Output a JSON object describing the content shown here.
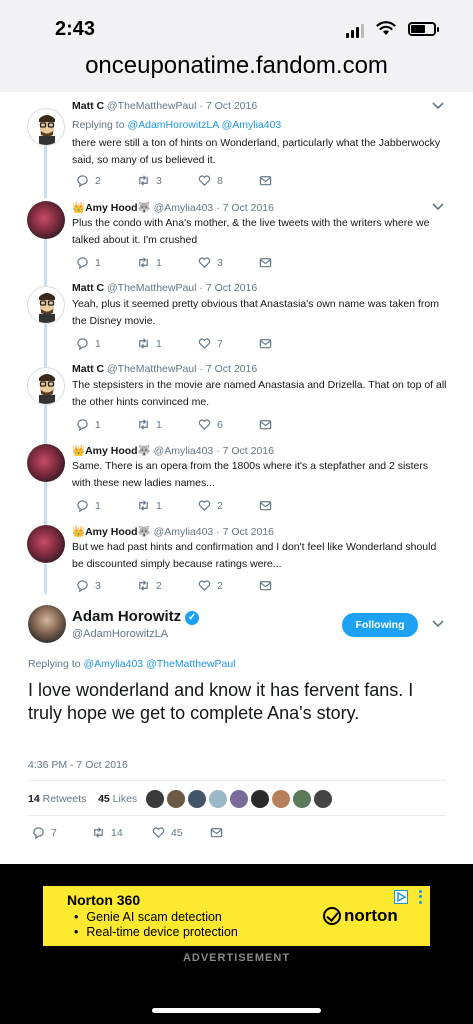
{
  "status_bar": {
    "time": "2:43"
  },
  "browser": {
    "url": "onceuponatime.fandom.com"
  },
  "thread": [
    {
      "name": "Matt C",
      "handle": "@TheMatthewPaul",
      "date": "7 Oct 2016",
      "replying_label": "Replying to",
      "replying_to": [
        "@AdamHorowitzLA",
        "@Amylia403"
      ],
      "text": "there were still a ton of hints on Wonderland, particularly what the Jabberwocky said, so many of us believed it.",
      "replies": "2",
      "retweets": "3",
      "likes": "8"
    },
    {
      "name": "Amy Hood",
      "handle": "@Amylia403",
      "date": "7 Oct 2016",
      "text": "Plus the condo with Ana's mother, & the live tweets with the writers where we talked about it. I'm crushed",
      "replies": "1",
      "retweets": "1",
      "likes": "3"
    },
    {
      "name": "Matt C",
      "handle": "@TheMatthewPaul",
      "date": "7 Oct 2016",
      "text": "Yeah, plus it seemed pretty obvious that Anastasia's own name was taken from the Disney movie.",
      "replies": "1",
      "retweets": "1",
      "likes": "7"
    },
    {
      "name": "Matt C",
      "handle": "@TheMatthewPaul",
      "date": "7 Oct 2016",
      "text": "The stepsisters in the movie are named Anastasia and Drizella. That on top of all the other hints convinced me.",
      "replies": "1",
      "retweets": "1",
      "likes": "6"
    },
    {
      "name": "Amy Hood",
      "handle": "@Amylia403",
      "date": "7 Oct 2016",
      "text": "Same. There is an opera from the 1800s where it's a stepfather and 2 sisters with these new ladies names...",
      "replies": "1",
      "retweets": "1",
      "likes": "2"
    },
    {
      "name": "Amy Hood",
      "handle": "@Amylia403",
      "date": "7 Oct 2016",
      "text": "But we had past hints and confirmation and I don't feel like Wonderland should be discounted simply because ratings were...",
      "replies": "3",
      "retweets": "2",
      "likes": "2"
    }
  ],
  "main_tweet": {
    "name": "Adam Horowitz",
    "handle": "@AdamHorowitzLA",
    "follow_label": "Following",
    "replying_label": "Replying to",
    "replying_to": [
      "@Amylia403",
      "@TheMatthewPaul"
    ],
    "text": "I love wonderland and know it has fervent fans.  I truly hope we get to complete Ana's story.",
    "timestamp": "4:36 PM - 7 Oct 2016",
    "retweets_count": "14",
    "retweets_label": "Retweets",
    "likes_count": "45",
    "likes_label": "Likes",
    "reply_count": "7",
    "retweet_action_count": "14",
    "like_action_count": "45"
  },
  "ad": {
    "title": "Norton 360",
    "bullets": [
      "Genie AI scam detection",
      "Real-time device protection"
    ],
    "brand": "norton",
    "label": "ADVERTISEMENT"
  },
  "colors": {
    "accent": "#1da1f2",
    "link": "#1b95e0",
    "ad_background": "#fde92f",
    "thread_line": "#c6dff2"
  }
}
